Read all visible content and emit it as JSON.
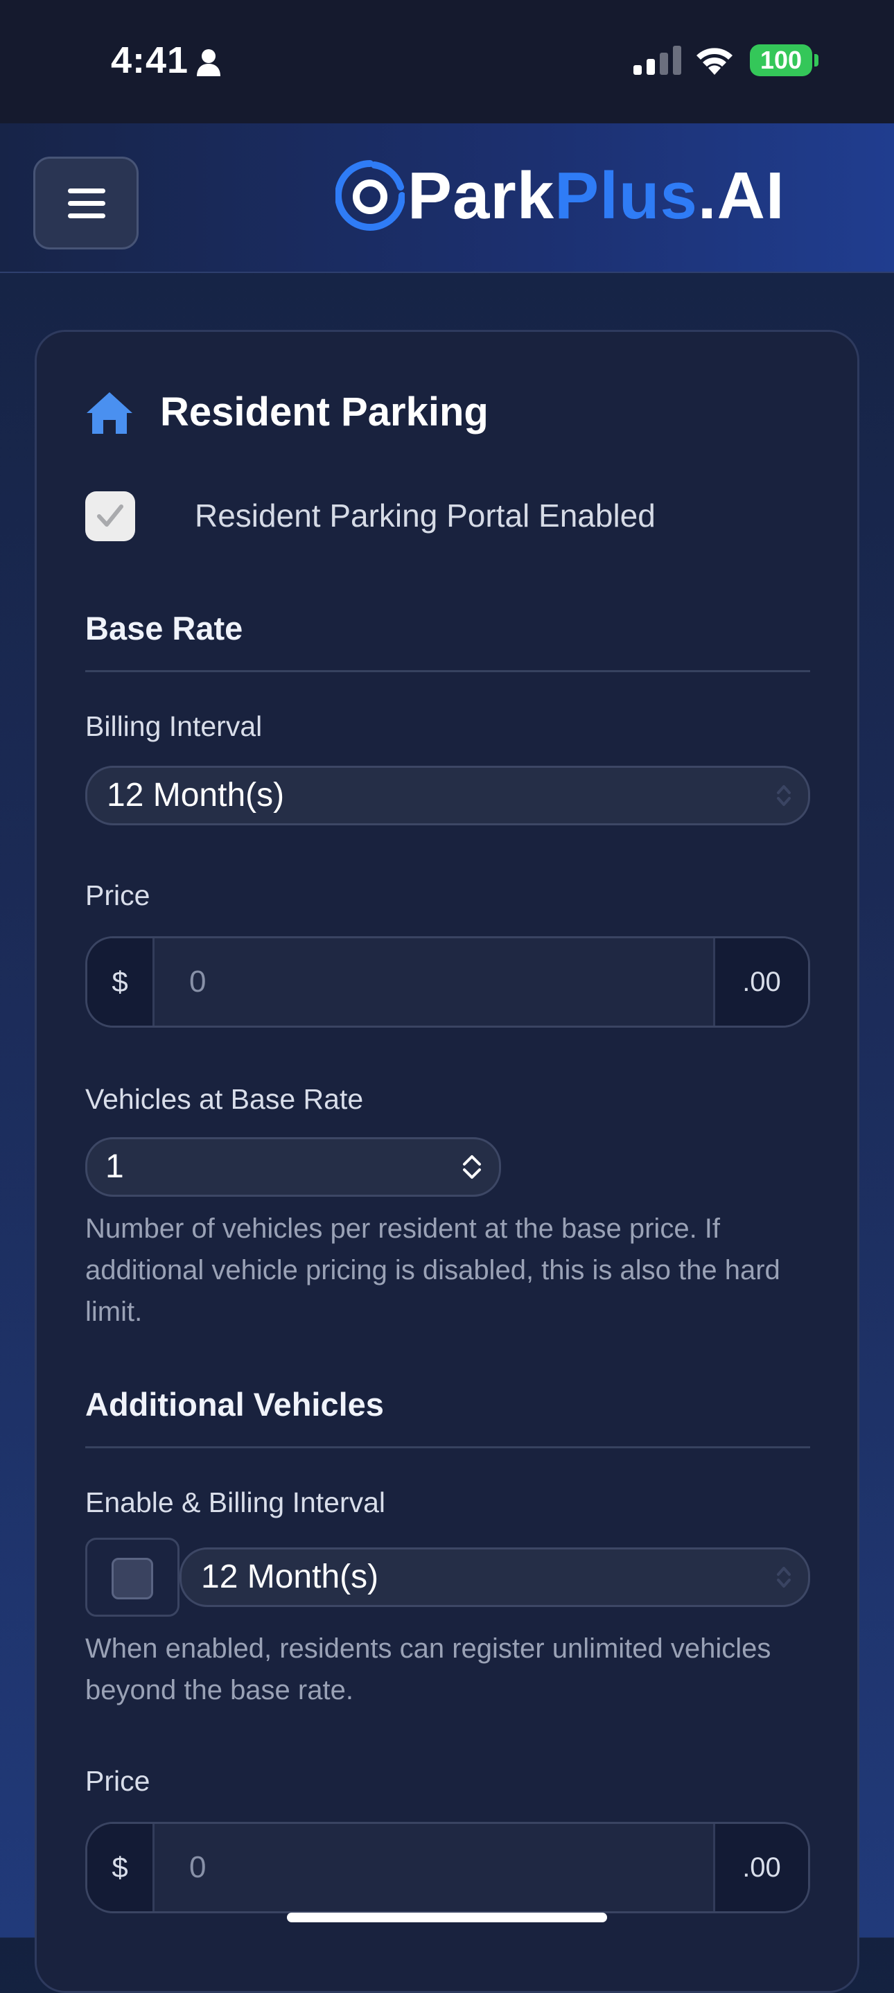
{
  "status_bar": {
    "time": "4:41",
    "battery": "100"
  },
  "header": {
    "brand": {
      "part1": "Park",
      "part2": "Plus",
      "part3": ".AI"
    }
  },
  "card": {
    "title": "Resident Parking",
    "portal_enabled_label": "Resident Parking Portal Enabled",
    "portal_enabled": true,
    "base_rate": {
      "heading": "Base Rate",
      "billing_interval_label": "Billing Interval",
      "billing_interval_value": "12 Month(s)",
      "price_label": "Price",
      "price_prefix": "$",
      "price_placeholder": "0",
      "price_suffix": ".00",
      "vehicles_label": "Vehicles at Base Rate",
      "vehicles_value": "1",
      "vehicles_help": "Number of vehicles per resident at the base price. If additional vehicle pricing is disabled, this is also the hard limit."
    },
    "additional_vehicles": {
      "heading": "Additional Vehicles",
      "enable_label": "Enable & Billing Interval",
      "enabled": false,
      "billing_interval_value": "12 Month(s)",
      "help": "When enabled, residents can register unlimited vehicles beyond the base rate.",
      "price_label": "Price",
      "price_prefix": "$",
      "price_placeholder": "0",
      "price_suffix": ".00"
    }
  },
  "colors": {
    "accent": "#2f7cf6",
    "battery": "#34c759",
    "card_bg": "#19223e"
  }
}
